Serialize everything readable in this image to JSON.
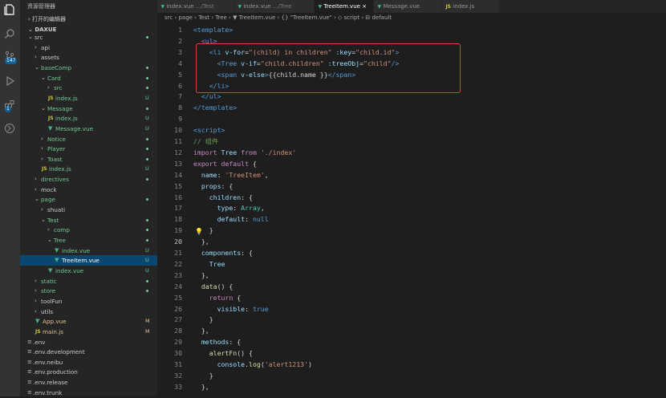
{
  "sidebar": {
    "title": "资源管理器",
    "open_editors": "打开的编辑器",
    "root": "DAXUE",
    "items": [
      {
        "label": "src",
        "depth": 0,
        "kind": "folder",
        "open": true,
        "status": "dot",
        "color": "#cccccc"
      },
      {
        "label": "api",
        "depth": 1,
        "kind": "folder",
        "open": false,
        "status": "",
        "color": "#cccccc"
      },
      {
        "label": "assets",
        "depth": 1,
        "kind": "folder",
        "open": false,
        "status": "",
        "color": "#cccccc"
      },
      {
        "label": "baseComp",
        "depth": 1,
        "kind": "folder",
        "open": true,
        "status": "dot",
        "color": "#73c991"
      },
      {
        "label": "Card",
        "depth": 2,
        "kind": "folder",
        "open": true,
        "status": "dot",
        "color": "#73c991"
      },
      {
        "label": "src",
        "depth": 3,
        "kind": "folder",
        "open": false,
        "status": "dot",
        "color": "#73c991"
      },
      {
        "label": "index.js",
        "depth": 3,
        "kind": "js",
        "status": "U",
        "color": "#73c991"
      },
      {
        "label": "Message",
        "depth": 2,
        "kind": "folder",
        "open": true,
        "status": "dot",
        "color": "#73c991"
      },
      {
        "label": "index.js",
        "depth": 3,
        "kind": "js",
        "status": "U",
        "color": "#73c991"
      },
      {
        "label": "Message.vue",
        "depth": 3,
        "kind": "vue",
        "status": "U",
        "color": "#73c991"
      },
      {
        "label": "Notice",
        "depth": 2,
        "kind": "folder",
        "open": false,
        "status": "dot",
        "color": "#73c991"
      },
      {
        "label": "Player",
        "depth": 2,
        "kind": "folder",
        "open": false,
        "status": "dot",
        "color": "#73c991"
      },
      {
        "label": "Toast",
        "depth": 2,
        "kind": "folder",
        "open": false,
        "status": "dot",
        "color": "#73c991"
      },
      {
        "label": "index.js",
        "depth": 2,
        "kind": "js",
        "status": "U",
        "color": "#73c991"
      },
      {
        "label": "directives",
        "depth": 1,
        "kind": "folder",
        "open": false,
        "status": "dot",
        "color": "#73c991"
      },
      {
        "label": "mock",
        "depth": 1,
        "kind": "folder",
        "open": false,
        "status": "",
        "color": "#cccccc"
      },
      {
        "label": "page",
        "depth": 1,
        "kind": "folder",
        "open": true,
        "status": "dot",
        "color": "#73c991"
      },
      {
        "label": "shuati",
        "depth": 2,
        "kind": "folder",
        "open": false,
        "status": "",
        "color": "#cccccc"
      },
      {
        "label": "Test",
        "depth": 2,
        "kind": "folder",
        "open": true,
        "status": "dot",
        "color": "#73c991"
      },
      {
        "label": "comp",
        "depth": 3,
        "kind": "folder",
        "open": false,
        "status": "dot",
        "color": "#73c991"
      },
      {
        "label": "Tree",
        "depth": 3,
        "kind": "folder",
        "open": true,
        "status": "dot",
        "color": "#73c991"
      },
      {
        "label": "index.vue",
        "depth": 4,
        "kind": "vue",
        "status": "U",
        "color": "#73c991"
      },
      {
        "label": "TreeItem.vue",
        "depth": 4,
        "kind": "vue",
        "status": "U",
        "color": "#ffffff",
        "selected": true
      },
      {
        "label": "index.vue",
        "depth": 3,
        "kind": "vue",
        "status": "U",
        "color": "#73c991"
      },
      {
        "label": "static",
        "depth": 1,
        "kind": "folder",
        "open": false,
        "status": "dot",
        "color": "#73c991"
      },
      {
        "label": "store",
        "depth": 1,
        "kind": "folder",
        "open": false,
        "status": "dot",
        "color": "#73c991"
      },
      {
        "label": "toolFun",
        "depth": 1,
        "kind": "folder",
        "open": false,
        "status": "",
        "color": "#cccccc"
      },
      {
        "label": "utils",
        "depth": 1,
        "kind": "folder",
        "open": false,
        "status": "",
        "color": "#cccccc"
      },
      {
        "label": "App.vue",
        "depth": 1,
        "kind": "vue",
        "status": "M",
        "color": "#e2c08d"
      },
      {
        "label": "main.js",
        "depth": 1,
        "kind": "js",
        "status": "M",
        "color": "#e2c08d"
      },
      {
        "label": ".env",
        "depth": 0,
        "kind": "file",
        "status": "",
        "color": "#cccccc"
      },
      {
        "label": ".env.development",
        "depth": 0,
        "kind": "file",
        "status": "",
        "color": "#cccccc"
      },
      {
        "label": ".env.neibu",
        "depth": 0,
        "kind": "file",
        "status": "",
        "color": "#cccccc"
      },
      {
        "label": ".env.production",
        "depth": 0,
        "kind": "file",
        "status": "",
        "color": "#cccccc"
      },
      {
        "label": ".env.release",
        "depth": 0,
        "kind": "file",
        "status": "",
        "color": "#cccccc"
      },
      {
        "label": ".env.trunk",
        "depth": 0,
        "kind": "file",
        "status": "",
        "color": "#cccccc"
      }
    ]
  },
  "activity": {
    "search_badge": "147",
    "ext_badge": "1"
  },
  "tabs": [
    {
      "label": "index.vue",
      "desc": ".../Test",
      "kind": "vue",
      "active": false
    },
    {
      "label": "index.vue",
      "desc": ".../Tree",
      "kind": "vue",
      "active": false
    },
    {
      "label": "TreeItem.vue",
      "desc": "",
      "kind": "vue",
      "active": true,
      "close": "×"
    },
    {
      "label": "Message.vue",
      "desc": "",
      "kind": "vue",
      "active": false
    },
    {
      "label": "index.js",
      "desc": "",
      "kind": "js",
      "active": false
    }
  ],
  "breadcrumb": "src › page › Test › Tree › ▼ TreeItem.vue › {} \"TreeItem.vue\" › ◇ script › ⊟ default",
  "editor": {
    "current_line": 20,
    "lightbulb_line": 19,
    "lines": [
      {
        "n": "1",
        "html": "<span class='tg'>&lt;template&gt;</span>"
      },
      {
        "n": "2",
        "html": "  <span class='tg'>&lt;ul&gt;</span>"
      },
      {
        "n": "3",
        "html": "    <span class='tg'>&lt;li</span> <span class='at'>v-for</span><span class='pn'>=</span><span class='st'>\"(child) in children\"</span> <span class='at'>:key</span><span class='pn'>=</span><span class='st'>\"child.id\"</span><span class='tg'>&gt;</span>"
      },
      {
        "n": "4",
        "html": "      <span class='tg'>&lt;Tree</span> <span class='at'>v-if</span><span class='pn'>=</span><span class='st'>\"child.children\"</span> <span class='at'>:treeObj</span><span class='pn'>=</span><span class='st'>\"child\"</span><span class='tg'>/&gt;</span>"
      },
      {
        "n": "5",
        "html": "      <span class='tg'>&lt;span</span> <span class='at'>v-else</span><span class='tg'>&gt;</span>{{child.name }}<span class='tg'>&lt;/span&gt;</span>"
      },
      {
        "n": "6",
        "html": "    <span class='tg'>&lt;/li&gt;</span>"
      },
      {
        "n": "7",
        "html": "  <span class='tg'>&lt;/ul&gt;</span>"
      },
      {
        "n": "8",
        "html": "<span class='tg'>&lt;/template&gt;</span>"
      },
      {
        "n": "9",
        "html": ""
      },
      {
        "n": "10",
        "html": "<span class='tg'>&lt;script&gt;</span>"
      },
      {
        "n": "11",
        "html": "<span class='cm'>// 组件</span>"
      },
      {
        "n": "12",
        "html": "<span class='kw'>import</span> <span class='at'>Tree</span> <span class='kw'>from</span> <span class='st'>'./index'</span>"
      },
      {
        "n": "13",
        "html": "<span class='kw'>export</span> <span class='kw'>default</span> {"
      },
      {
        "n": "14",
        "html": "  <span class='at'>name</span>: <span class='st'>'TreeItem'</span>,"
      },
      {
        "n": "15",
        "html": "  <span class='at'>props</span>: {"
      },
      {
        "n": "16",
        "html": "    <span class='at'>children</span>: {"
      },
      {
        "n": "17",
        "html": "      <span class='at'>type</span>: <span class='ty'>Array</span>,"
      },
      {
        "n": "18",
        "html": "      <span class='at'>default</span>: <span class='bl'>null</span>"
      },
      {
        "n": "19",
        "html": "    }"
      },
      {
        "n": "20",
        "html": "  },"
      },
      {
        "n": "21",
        "html": "  <span class='at'>components</span>: {"
      },
      {
        "n": "22",
        "html": "    <span class='at'>Tree</span>"
      },
      {
        "n": "23",
        "html": "  },"
      },
      {
        "n": "24",
        "html": "  <span class='fn'>data</span>() {"
      },
      {
        "n": "25",
        "html": "    <span class='kw'>return</span> {"
      },
      {
        "n": "26",
        "html": "      <span class='at'>visible</span>: <span class='bl'>true</span>"
      },
      {
        "n": "27",
        "html": "    }"
      },
      {
        "n": "28",
        "html": "  },"
      },
      {
        "n": "29",
        "html": "  <span class='at'>methods</span>: {"
      },
      {
        "n": "30",
        "html": "    <span class='fn'>alertFn</span>() {"
      },
      {
        "n": "31",
        "html": "      <span class='at'>console</span>.<span class='fn'>log</span>(<span class='st'>'alert1213'</span>)"
      },
      {
        "n": "32",
        "html": "    }"
      },
      {
        "n": "33",
        "html": "  },"
      }
    ]
  }
}
